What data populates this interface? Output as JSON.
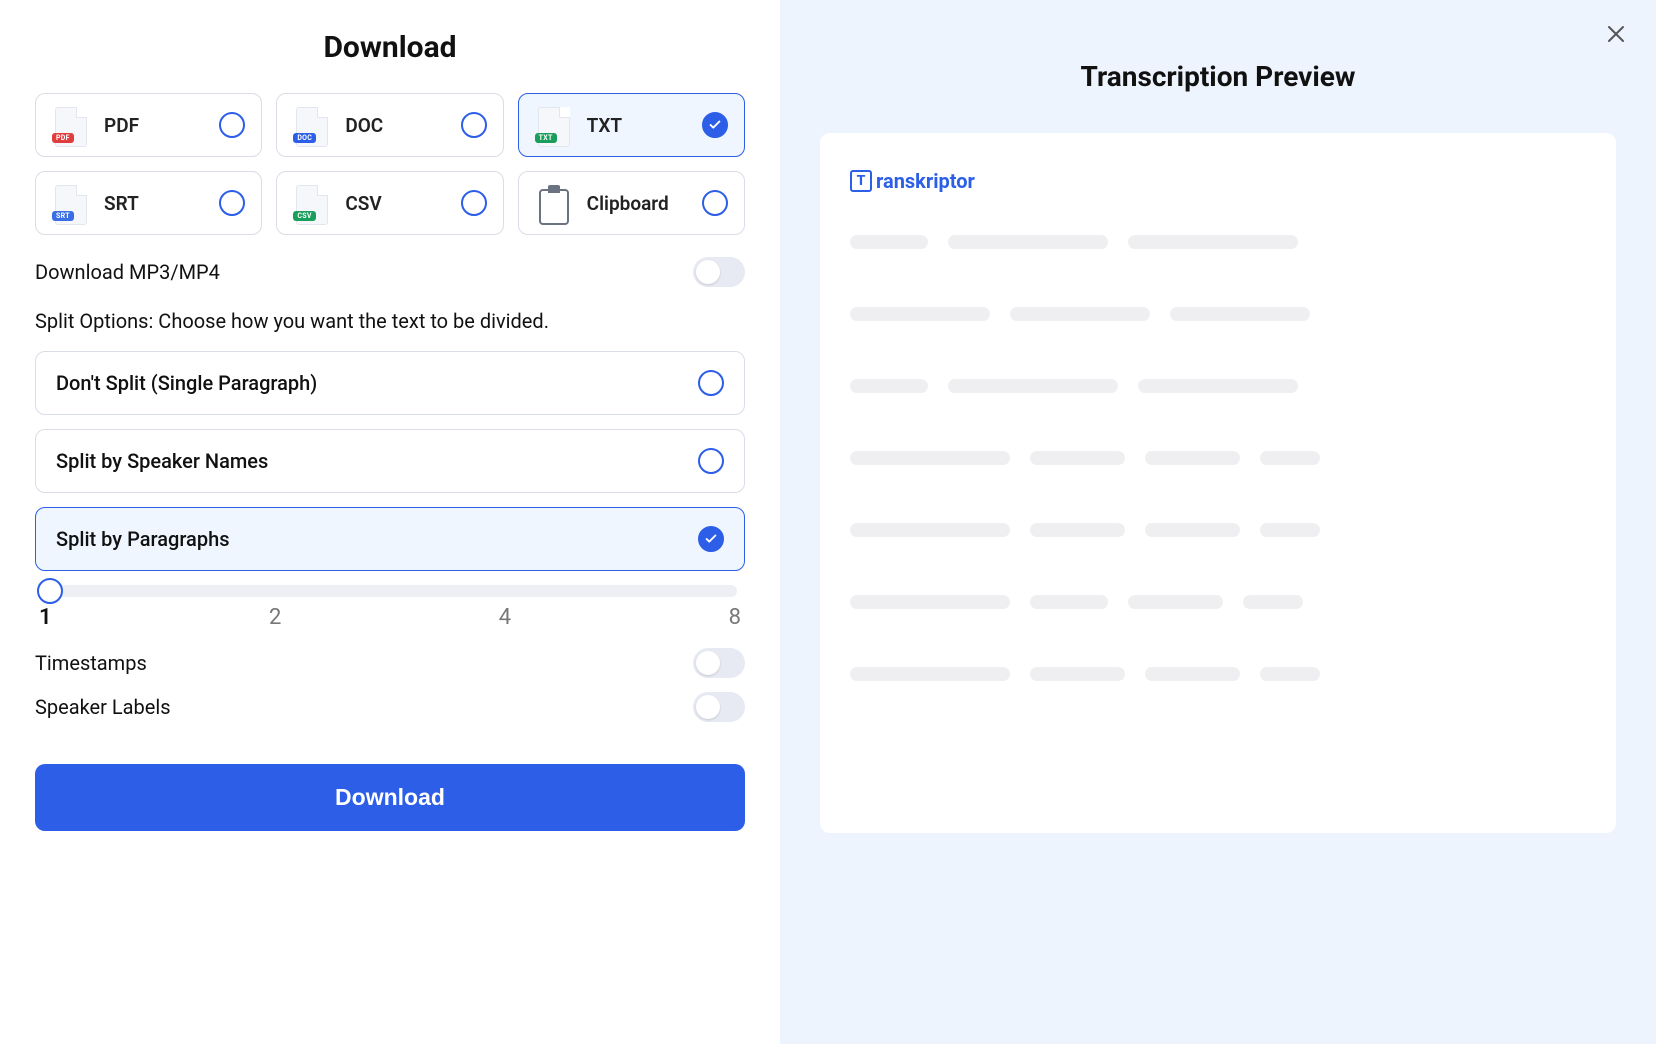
{
  "left": {
    "title": "Download",
    "formats": [
      {
        "label": "PDF",
        "badge": "PDF",
        "badgeClass": "badge-pdf",
        "selected": false
      },
      {
        "label": "DOC",
        "badge": "DOC",
        "badgeClass": "badge-doc",
        "selected": false
      },
      {
        "label": "TXT",
        "badge": "TXT",
        "badgeClass": "badge-txt",
        "selected": true
      },
      {
        "label": "SRT",
        "badge": "SRT",
        "badgeClass": "badge-srt",
        "selected": false
      },
      {
        "label": "CSV",
        "badge": "CSV",
        "badgeClass": "badge-csv",
        "selected": false
      },
      {
        "label": "Clipboard",
        "clipboard": true,
        "selected": false
      }
    ],
    "download_media_label": "Download MP3/MP4",
    "download_media_on": false,
    "split_heading": "Split Options: Choose how you want the text to be divided.",
    "split_options": [
      {
        "label": "Don't Split (Single Paragraph)",
        "selected": false
      },
      {
        "label": "Split by Speaker Names",
        "selected": false
      },
      {
        "label": "Split by Paragraphs",
        "selected": true
      }
    ],
    "slider": {
      "value": 1,
      "marks": [
        "1",
        "2",
        "4",
        "8"
      ]
    },
    "timestamps_label": "Timestamps",
    "timestamps_on": false,
    "speaker_labels_label": "Speaker Labels",
    "speaker_labels_on": false,
    "download_button": "Download"
  },
  "right": {
    "title": "Transcription Preview",
    "brand_t": "T",
    "brand_rest": "ranskriptor"
  }
}
